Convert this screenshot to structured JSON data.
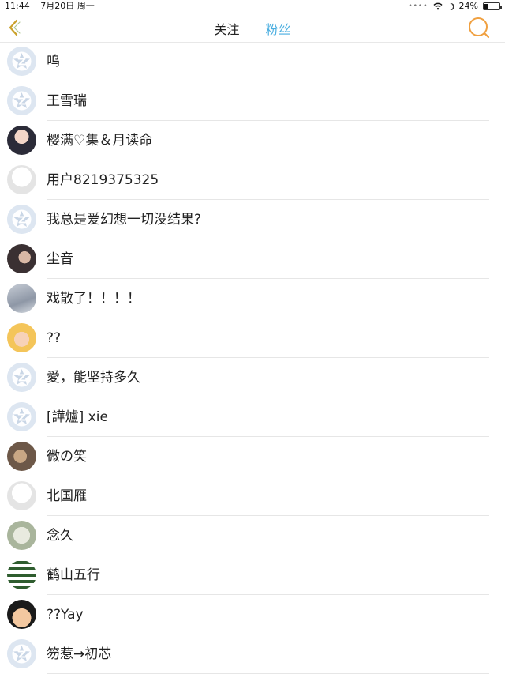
{
  "status_bar": {
    "time": "11:44",
    "date": "7月20日 周一",
    "battery": "24%",
    "battery_level": 0.24
  },
  "nav": {
    "tabs": [
      "关注",
      "粉丝"
    ],
    "active_tab": "粉丝",
    "tab_color_active": "#4aaee0",
    "icon_color": "#f0a040"
  },
  "fans": [
    {
      "name": "呜",
      "avatar": "default-avatar"
    },
    {
      "name": "王雪瑞",
      "avatar": "default-avatar"
    },
    {
      "name": "樱满♡集＆月读命",
      "avatar": "photo-avatar"
    },
    {
      "name": "用户8219375325",
      "avatar": "blank-avatar"
    },
    {
      "name": "我总是爱幻想一切没结果?",
      "avatar": "default-avatar"
    },
    {
      "name": "尘音",
      "avatar": "photo-avatar"
    },
    {
      "name": "戏散了！！！！",
      "avatar": "photo-avatar"
    },
    {
      "name": "??",
      "avatar": "photo-avatar"
    },
    {
      "name": "愛，能坚持多久",
      "avatar": "default-avatar"
    },
    {
      "name": "[譁爐] xie",
      "avatar": "default-avatar"
    },
    {
      "name": "微の笑",
      "avatar": "photo-avatar"
    },
    {
      "name": "北国雁",
      "avatar": "blank-avatar"
    },
    {
      "name": "念久",
      "avatar": "photo-avatar"
    },
    {
      "name": "鹤山五行",
      "avatar": "photo-avatar"
    },
    {
      "name": "??Yay",
      "avatar": "photo-avatar"
    },
    {
      "name": "笏惹→初芯",
      "avatar": "default-avatar"
    }
  ]
}
